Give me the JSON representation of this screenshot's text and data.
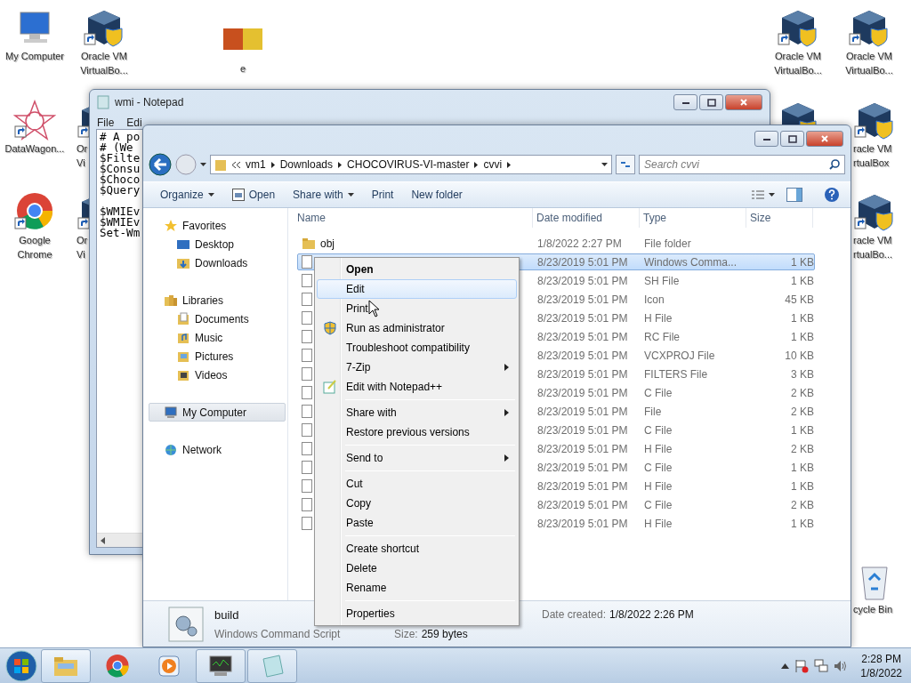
{
  "desktop_icons": [
    {
      "kind": "computer",
      "shortcut": false,
      "label": [
        "My Computer"
      ]
    },
    {
      "kind": "virtualbox",
      "shortcut": true,
      "label": [
        "Oracle VM",
        "VirtualBo..."
      ]
    },
    {
      "kind": "picture",
      "shortcut": false,
      "label": [
        "e"
      ]
    },
    {
      "kind": "virtualbox",
      "shortcut": true,
      "label": [
        "Oracle VM",
        "VirtualBo..."
      ]
    },
    {
      "kind": "virtualbox",
      "shortcut": true,
      "label": [
        "Oracle VM",
        "VirtualBo..."
      ]
    },
    {
      "kind": "star",
      "shortcut": true,
      "label": [
        "DataWagon..."
      ]
    },
    {
      "kind": "virtualbox",
      "shortcut": true,
      "label": [
        "Or",
        "Vi"
      ]
    },
    {
      "kind": "virtualbox"
    },
    {
      "kind": "virtualbox",
      "shortcut": true,
      "label": [
        "racle VM",
        "rtualBox"
      ]
    },
    {
      "kind": "chrome",
      "shortcut": true,
      "label": [
        "Google",
        "Chrome"
      ]
    },
    {
      "kind": "virtualbox",
      "shortcut": true,
      "label": [
        "Or",
        "Vi"
      ]
    },
    {
      "kind": "virtualbox",
      "shortcut": true,
      "label": [
        "racle VM",
        "rtualBo..."
      ]
    },
    {
      "kind": "recycle",
      "shortcut": false,
      "label": [
        "cycle Bin"
      ]
    }
  ],
  "notepad": {
    "title": "wmi - Notepad",
    "menu": [
      "File",
      "Edi"
    ],
    "blocks": [
      [
        "# A po",
        "# (We",
        "$Filte",
        "$Consu",
        "$Choco",
        "$Query"
      ],
      [
        "$WMIEv",
        "$WMIEv",
        "Set-Wm"
      ]
    ]
  },
  "explorer": {
    "breadcrumbs": [
      "vm1",
      "Downloads",
      "CHOCOVIRUS-VI-master",
      "cvvi"
    ],
    "search": {
      "placeholder": "Search cvvi"
    },
    "toolbar": [
      {
        "label": "Organize",
        "dropdown": true
      },
      {
        "label": "Open",
        "dropdown": false
      },
      {
        "label": "Share with",
        "dropdown": true
      },
      {
        "label": "Print",
        "dropdown": false
      },
      {
        "label": "New folder",
        "dropdown": false
      }
    ],
    "nav": [
      {
        "label": "Favorites",
        "kind": "star",
        "selected": false,
        "children": [
          {
            "label": "Desktop",
            "kind": "desktop",
            "selected": false
          },
          {
            "label": "Downloads",
            "kind": "downloads",
            "selected": false
          }
        ]
      },
      {
        "label": "Libraries",
        "kind": "libraries",
        "selected": false,
        "children": [
          {
            "label": "Documents",
            "kind": "documents",
            "selected": false
          },
          {
            "label": "Music",
            "kind": "music",
            "selected": false
          },
          {
            "label": "Pictures",
            "kind": "pictures",
            "selected": false
          },
          {
            "label": "Videos",
            "kind": "videos",
            "selected": false
          }
        ]
      },
      {
        "label": "My Computer",
        "kind": "computer",
        "selected": true
      },
      {
        "label": "Network",
        "kind": "network",
        "selected": false
      }
    ],
    "columns": [
      "Name",
      "Date modified",
      "Type",
      "Size"
    ],
    "rows": [
      {
        "kind": "folder",
        "name": "obj",
        "date": "1/8/2022 2:27 PM",
        "type": "File folder",
        "selected": false
      },
      {
        "kind": "file",
        "date": "8/23/2019 5:01 PM",
        "type": "Windows Comma...",
        "size": "1 KB",
        "selected": true
      },
      {
        "kind": "file",
        "date": "8/23/2019 5:01 PM",
        "type": "SH File",
        "size": "1 KB",
        "selected": false
      },
      {
        "kind": "file",
        "date": "8/23/2019 5:01 PM",
        "type": "Icon",
        "size": "45 KB",
        "selected": false
      },
      {
        "kind": "file",
        "date": "8/23/2019 5:01 PM",
        "type": "H File",
        "size": "1 KB",
        "selected": false
      },
      {
        "kind": "file",
        "date": "8/23/2019 5:01 PM",
        "type": "RC File",
        "size": "1 KB",
        "selected": false
      },
      {
        "kind": "file",
        "date": "8/23/2019 5:01 PM",
        "type": "VCXPROJ File",
        "size": "10 KB",
        "selected": false
      },
      {
        "kind": "file",
        "date": "8/23/2019 5:01 PM",
        "type": "FILTERS File",
        "size": "3 KB",
        "selected": false
      },
      {
        "kind": "file",
        "date": "8/23/2019 5:01 PM",
        "type": "C File",
        "size": "2 KB",
        "selected": false
      },
      {
        "kind": "file",
        "date": "8/23/2019 5:01 PM",
        "type": "File",
        "size": "2 KB",
        "selected": false
      },
      {
        "kind": "file",
        "date": "8/23/2019 5:01 PM",
        "type": "C File",
        "size": "1 KB",
        "selected": false
      },
      {
        "kind": "file",
        "date": "8/23/2019 5:01 PM",
        "type": "H File",
        "size": "2 KB",
        "selected": false
      },
      {
        "kind": "file",
        "date": "8/23/2019 5:01 PM",
        "type": "C File",
        "size": "1 KB",
        "selected": false
      },
      {
        "kind": "file",
        "date": "8/23/2019 5:01 PM",
        "type": "H File",
        "size": "1 KB",
        "selected": false
      },
      {
        "kind": "file",
        "date": "8/23/2019 5:01 PM",
        "type": "C File",
        "size": "2 KB",
        "selected": false
      },
      {
        "kind": "file",
        "date": "8/23/2019 5:01 PM",
        "type": "H File",
        "size": "1 KB",
        "selected": false
      }
    ],
    "details": {
      "name": "build",
      "type": "Windows Command Script",
      "created_label": "Date created:",
      "created": "1/8/2022 2:26 PM",
      "size_label": "Size:",
      "size": "259 bytes"
    }
  },
  "context_menu": [
    [
      {
        "label": "Open",
        "default": true,
        "highlighted": false,
        "submenu": false
      },
      {
        "label": "Edit",
        "default": false,
        "highlighted": true,
        "submenu": false
      },
      {
        "label": "Print",
        "default": false,
        "highlighted": false,
        "submenu": false
      },
      {
        "label": "Run as administrator",
        "default": false,
        "highlighted": false,
        "submenu": false
      },
      {
        "label": "Troubleshoot compatibility",
        "default": false,
        "highlighted": false,
        "submenu": false
      },
      {
        "label": "7-Zip",
        "default": false,
        "highlighted": false,
        "submenu": true
      },
      {
        "label": "Edit with Notepad++",
        "default": false,
        "highlighted": false,
        "submenu": false
      }
    ],
    [
      {
        "label": "Share with",
        "default": false,
        "highlighted": false,
        "submenu": true
      },
      {
        "label": "Restore previous versions",
        "default": false,
        "highlighted": false,
        "submenu": false
      }
    ],
    [
      {
        "label": "Send to",
        "default": false,
        "highlighted": false,
        "submenu": true
      }
    ],
    [
      {
        "label": "Cut",
        "default": false,
        "highlighted": false,
        "submenu": false
      },
      {
        "label": "Copy",
        "default": false,
        "highlighted": false,
        "submenu": false
      },
      {
        "label": "Paste",
        "default": false,
        "highlighted": false,
        "submenu": false
      }
    ],
    [
      {
        "label": "Create shortcut",
        "default": false,
        "highlighted": false,
        "submenu": false
      },
      {
        "label": "Delete",
        "default": false,
        "highlighted": false,
        "submenu": false
      },
      {
        "label": "Rename",
        "default": false,
        "highlighted": false,
        "submenu": false
      }
    ],
    [
      {
        "label": "Properties",
        "default": false,
        "highlighted": false,
        "submenu": false
      }
    ]
  ],
  "taskbar": {
    "apps": [
      {
        "kind": "explorer",
        "running": true,
        "active": true
      },
      {
        "kind": "chrome",
        "running": false,
        "active": false
      },
      {
        "kind": "media",
        "running": false,
        "active": false
      },
      {
        "kind": "monitor",
        "running": true,
        "active": false
      },
      {
        "kind": "notepad",
        "running": true,
        "active": false
      }
    ],
    "time": "2:28 PM",
    "date": "1/8/2022"
  }
}
